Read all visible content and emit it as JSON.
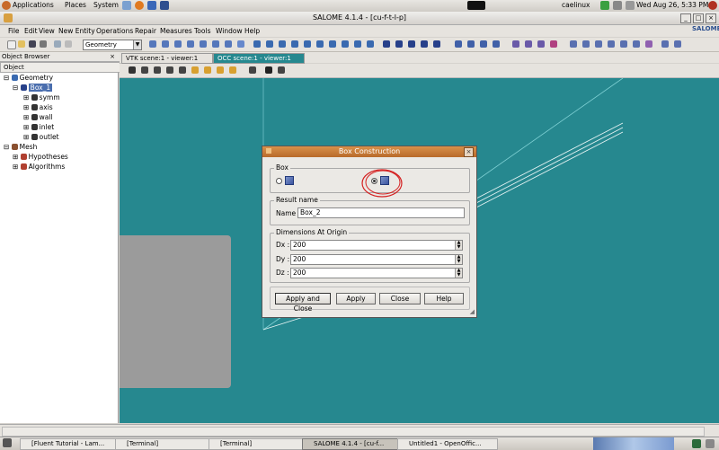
{
  "top_panel": {
    "applications": "Applications",
    "places": "Places",
    "system": "System",
    "user": "caelinux",
    "datetime": "Wed Aug 26,  5:33 PM"
  },
  "window": {
    "title": "SALOME 4.1.4 - [cu-f-t-l-p]",
    "brand": "SALOME"
  },
  "menu": [
    "File",
    "Edit",
    "View",
    "New Entity",
    "Operations",
    "Repair",
    "Measures",
    "Tools",
    "Window",
    "Help"
  ],
  "toolbar": {
    "module": "Geometry"
  },
  "object_browser": {
    "title": "Object Browser",
    "column": "Object",
    "tree": [
      {
        "label": "Geometry",
        "level": 0
      },
      {
        "label": "Box_1",
        "level": 1,
        "selected": true
      },
      {
        "label": "symm",
        "level": 2
      },
      {
        "label": "axis",
        "level": 2
      },
      {
        "label": "wall",
        "level": 2
      },
      {
        "label": "inlet",
        "level": 2
      },
      {
        "label": "outlet",
        "level": 2
      },
      {
        "label": "Mesh",
        "level": 0
      },
      {
        "label": "Hypotheses",
        "level": 1
      },
      {
        "label": "Algorithms",
        "level": 1
      }
    ]
  },
  "viewer_tabs": [
    {
      "label": "VTK scene:1 - viewer:1",
      "active": false
    },
    {
      "label": "OCC scene:1 - viewer:1",
      "active": true
    }
  ],
  "dialog": {
    "title": "Box Construction",
    "box_group": "Box",
    "result_group": "Result name",
    "name_label": "Name",
    "name_value": "Box_2",
    "dims_group": "Dimensions At Origin",
    "dims": [
      {
        "label": "Dx :",
        "value": "200"
      },
      {
        "label": "Dy :",
        "value": "200"
      },
      {
        "label": "Dz :",
        "value": "200"
      }
    ],
    "buttons": {
      "apply_close": "Apply and Close",
      "apply": "Apply",
      "close": "Close",
      "help": "Help"
    }
  },
  "taskbar": [
    {
      "label": "[Fluent Tutorial - Lam...",
      "active": false
    },
    {
      "label": "[Terminal]",
      "active": false
    },
    {
      "label": "[Terminal]",
      "active": false
    },
    {
      "label": "SALOME 4.1.4 - [cu-f...",
      "active": true
    },
    {
      "label": "Untitled1 - OpenOffic...",
      "active": false
    }
  ],
  "colors": {
    "viewer_bg": "#26888f",
    "dialog_title": "#c47a36",
    "selection": "#4a6eae",
    "annotation_circle": "#d42020"
  }
}
